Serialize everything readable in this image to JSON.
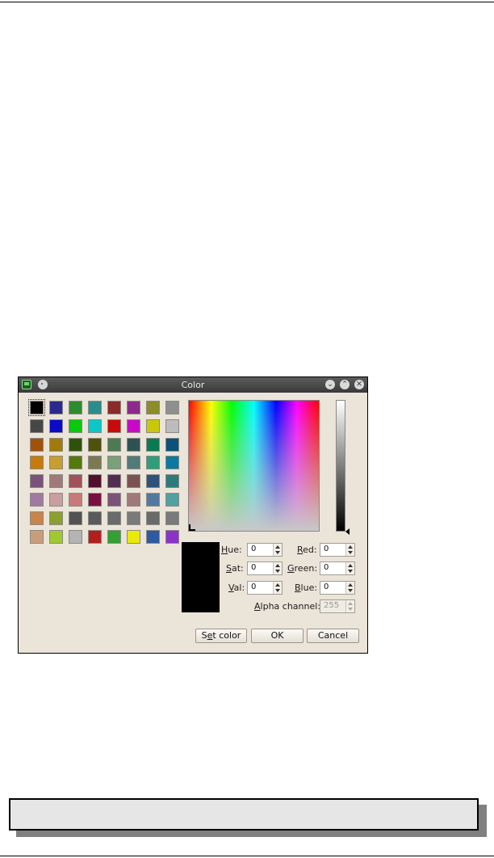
{
  "dialog": {
    "title": "Color",
    "titlebar_icons": [
      "app-icon",
      "pin-icon"
    ],
    "window_buttons": [
      {
        "name": "minimize-button",
        "glyph": "⌄"
      },
      {
        "name": "maximize-button",
        "glyph": "⌃"
      },
      {
        "name": "close-button",
        "glyph": "✕"
      }
    ]
  },
  "basic_colors": [
    [
      "#000000",
      "#2a2a8e",
      "#2d8c2d",
      "#2a8c8c",
      "#8c2a2a",
      "#8c2a8c",
      "#8c8c2a",
      "#8f8f8f"
    ],
    [
      "#474747",
      "#0a0ac8",
      "#0ac80a",
      "#0ac8c8",
      "#c80a0a",
      "#c80ac8",
      "#c8c80a",
      "#bcbcbc"
    ],
    [
      "#a0520a",
      "#a07a0a",
      "#2e520a",
      "#4e520a",
      "#4e7a52",
      "#2e5252",
      "#0a7a52",
      "#0a5278"
    ],
    [
      "#c87a0a",
      "#c89e2e",
      "#527a0a",
      "#7a7a52",
      "#7aa07a",
      "#527a7a",
      "#2e9e7a",
      "#0a7aa0"
    ],
    [
      "#7a527a",
      "#a07a7a",
      "#a0525a",
      "#52102e",
      "#522e52",
      "#7a5252",
      "#2e527a",
      "#2e7a7a"
    ],
    [
      "#a07aa0",
      "#c89e9e",
      "#c87a7a",
      "#7a1040",
      "#7a527a",
      "#a07a7a",
      "#527aa0",
      "#52a0a0"
    ],
    [
      "#c8844a",
      "#8ca02e",
      "#525252",
      "#5a5a5a",
      "#6a6a6a",
      "#7a7a7a",
      "#6a6a6a",
      "#7a7a7a"
    ],
    [
      "#c89e7a",
      "#a0c832",
      "#b4b4b4",
      "#b41e1e",
      "#32a032",
      "#eaea0a",
      "#2e5aa0",
      "#8c32c8"
    ]
  ],
  "fields": {
    "hue": {
      "label_pre": "",
      "label_key": "H",
      "label_post": "ue:",
      "value": "0"
    },
    "sat": {
      "label_pre": "",
      "label_key": "S",
      "label_post": "at:",
      "value": "0"
    },
    "val": {
      "label_pre": "",
      "label_key": "V",
      "label_post": "al:",
      "value": "0"
    },
    "red": {
      "label_pre": "",
      "label_key": "R",
      "label_post": "ed:",
      "value": "0"
    },
    "green": {
      "label_pre": "",
      "label_key": "G",
      "label_post": "reen:",
      "value": "0"
    },
    "blue": {
      "label_pre": "",
      "label_key": "B",
      "label_post": "lue:",
      "value": "0"
    },
    "alpha": {
      "label_pre": "",
      "label_key": "A",
      "label_post": "lpha channel:",
      "value": "255",
      "disabled": true
    }
  },
  "current_color": "#000000",
  "buttons": {
    "set_color_pre": "S",
    "set_color_key": "e",
    "set_color_post": "t color",
    "ok": "OK",
    "cancel": "Cancel"
  },
  "info_box": {
    "text": ""
  }
}
